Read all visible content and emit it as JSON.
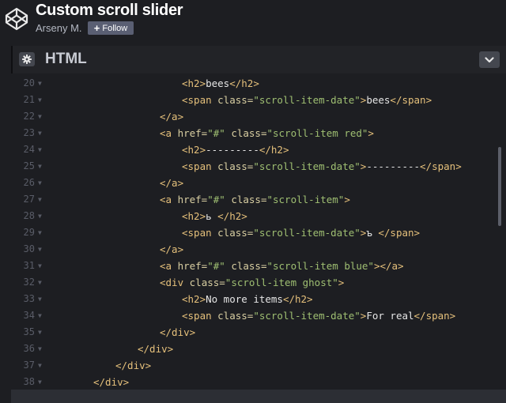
{
  "pen": {
    "title": "Custom scroll slider",
    "author": "Arseny M.",
    "follow_label": "Follow",
    "follow_icon": "plus-icon"
  },
  "panel": {
    "title": "HTML",
    "settings_icon": "gear-icon",
    "collapse_icon": "chevron-down-icon"
  },
  "colors": {
    "background": "#1d1e22",
    "tag": "#e5c07b",
    "attribute": "#d9cfa2",
    "string": "#9fbf72",
    "text": "#e6e6e6",
    "line_number": "#595c67"
  },
  "code_lines": [
    {
      "num": "20",
      "indent": 6,
      "tokens": [
        [
          "tag",
          "<h2>"
        ],
        [
          "txt",
          "bees"
        ],
        [
          "tag",
          "</h2>"
        ]
      ]
    },
    {
      "num": "21",
      "indent": 6,
      "tokens": [
        [
          "tag",
          "<span "
        ],
        [
          "attr",
          "class="
        ],
        [
          "str",
          "\"scroll-item-date\""
        ],
        [
          "tag",
          ">"
        ],
        [
          "txt",
          "bees"
        ],
        [
          "tag",
          "</span>"
        ]
      ]
    },
    {
      "num": "22",
      "indent": 5,
      "tokens": [
        [
          "tag",
          "</a>"
        ]
      ]
    },
    {
      "num": "23",
      "indent": 5,
      "tokens": [
        [
          "tag",
          "<a "
        ],
        [
          "attr",
          "href="
        ],
        [
          "str",
          "\"#\" "
        ],
        [
          "attr",
          "class="
        ],
        [
          "str",
          "\"scroll-item red\""
        ],
        [
          "tag",
          ">"
        ]
      ]
    },
    {
      "num": "24",
      "indent": 6,
      "tokens": [
        [
          "tag",
          "<h2>"
        ],
        [
          "txt",
          "---------"
        ],
        [
          "tag",
          "</h2>"
        ]
      ]
    },
    {
      "num": "25",
      "indent": 6,
      "tokens": [
        [
          "tag",
          "<span "
        ],
        [
          "attr",
          "class="
        ],
        [
          "str",
          "\"scroll-item-date\""
        ],
        [
          "tag",
          ">"
        ],
        [
          "txt",
          "---------"
        ],
        [
          "tag",
          "</span>"
        ]
      ]
    },
    {
      "num": "26",
      "indent": 5,
      "tokens": [
        [
          "tag",
          "</a>"
        ]
      ]
    },
    {
      "num": "27",
      "indent": 5,
      "tokens": [
        [
          "tag",
          "<a "
        ],
        [
          "attr",
          "href="
        ],
        [
          "str",
          "\"#\" "
        ],
        [
          "attr",
          "class="
        ],
        [
          "str",
          "\"scroll-item\""
        ],
        [
          "tag",
          ">"
        ]
      ]
    },
    {
      "num": "28",
      "indent": 6,
      "tokens": [
        [
          "tag",
          "<h2>"
        ],
        [
          "txt",
          "ь "
        ],
        [
          "tag",
          "</h2>"
        ]
      ]
    },
    {
      "num": "29",
      "indent": 6,
      "tokens": [
        [
          "tag",
          "<span "
        ],
        [
          "attr",
          "class="
        ],
        [
          "str",
          "\"scroll-item-date\""
        ],
        [
          "tag",
          ">"
        ],
        [
          "txt",
          "ъ "
        ],
        [
          "tag",
          "</span>"
        ]
      ]
    },
    {
      "num": "30",
      "indent": 5,
      "tokens": [
        [
          "tag",
          "</a>"
        ]
      ]
    },
    {
      "num": "31",
      "indent": 5,
      "tokens": [
        [
          "tag",
          "<a "
        ],
        [
          "attr",
          "href="
        ],
        [
          "str",
          "\"#\" "
        ],
        [
          "attr",
          "class="
        ],
        [
          "str",
          "\"scroll-item blue\""
        ],
        [
          "tag",
          "></a>"
        ]
      ]
    },
    {
      "num": "32",
      "indent": 5,
      "tokens": [
        [
          "tag",
          "<div "
        ],
        [
          "attr",
          "class="
        ],
        [
          "str",
          "\"scroll-item ghost\""
        ],
        [
          "tag",
          ">"
        ]
      ]
    },
    {
      "num": "33",
      "indent": 6,
      "tokens": [
        [
          "tag",
          "<h2>"
        ],
        [
          "txt",
          "No more items"
        ],
        [
          "tag",
          "</h2>"
        ]
      ]
    },
    {
      "num": "34",
      "indent": 6,
      "tokens": [
        [
          "tag",
          "<span "
        ],
        [
          "attr",
          "class="
        ],
        [
          "str",
          "\"scroll-item-date\""
        ],
        [
          "tag",
          ">"
        ],
        [
          "txt",
          "For real"
        ],
        [
          "tag",
          "</span>"
        ]
      ]
    },
    {
      "num": "35",
      "indent": 5,
      "tokens": [
        [
          "tag",
          "</div>"
        ]
      ]
    },
    {
      "num": "36",
      "indent": 4,
      "tokens": [
        [
          "tag",
          "</div>"
        ]
      ]
    },
    {
      "num": "37",
      "indent": 3,
      "tokens": [
        [
          "tag",
          "</div>"
        ]
      ]
    },
    {
      "num": "38",
      "indent": 2,
      "tokens": [
        [
          "tag",
          "</div>"
        ]
      ]
    }
  ]
}
